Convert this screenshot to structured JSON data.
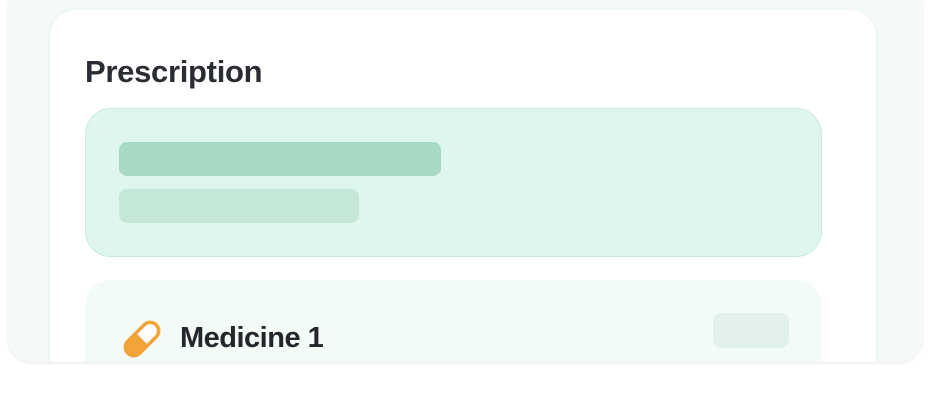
{
  "prescription": {
    "title": "Prescription"
  },
  "medicines": [
    {
      "name": "Medicine 1",
      "icon": "pill-icon"
    }
  ],
  "colors": {
    "info_background": "#dff6ee",
    "skeleton_primary": "#a8d9c4",
    "skeleton_secondary": "#c4e7d8",
    "medicine_card_background": "#f3fbf6",
    "pill_accent": "#f2a33a"
  }
}
